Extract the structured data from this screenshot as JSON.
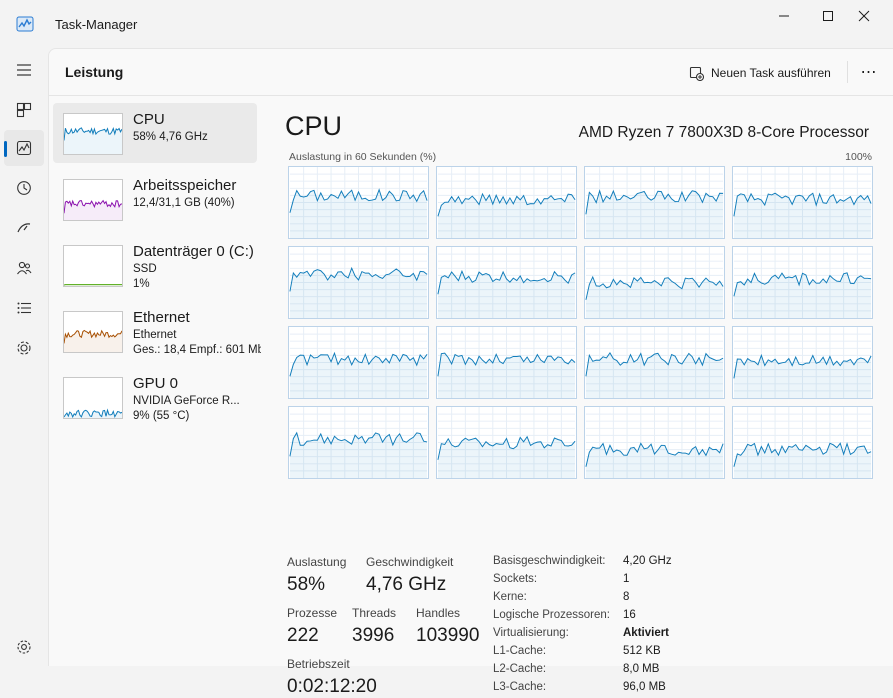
{
  "window": {
    "title": "Task-Manager"
  },
  "colors": {
    "cpu": "#117dbb",
    "memory": "#8b12ae",
    "disk": "#4da60c",
    "ethernet": "#a74f01",
    "gpu": "#117dbb"
  },
  "nav": {
    "items": [
      "menu-icon",
      "processes-icon",
      "performance-icon",
      "app-history-icon",
      "startup-icon",
      "users-icon",
      "details-icon",
      "services-icon"
    ],
    "settings": "settings-icon"
  },
  "header": {
    "title": "Leistung",
    "run_task_label": "Neuen Task ausführen",
    "more": "⋯"
  },
  "resources": [
    {
      "name": "CPU",
      "lines": [
        "58% 4,76 GHz"
      ],
      "usage": 58
    },
    {
      "name": "Arbeitsspeicher",
      "lines": [
        "12,4/31,1 GB (40%)"
      ],
      "usage": 40
    },
    {
      "name": "Datenträger 0 (C:)",
      "lines": [
        "SSD",
        "1%"
      ],
      "usage": 1
    },
    {
      "name": "Ethernet",
      "lines": [
        "Ethernet",
        "Ges.: 18,4 Empf.: 601 Mb"
      ],
      "usage": 45
    },
    {
      "name": "GPU 0",
      "lines": [
        "NVIDIA GeForce R...",
        "9% (55 °C)"
      ],
      "usage": 9
    }
  ],
  "detail": {
    "title": "CPU",
    "model": "AMD Ryzen 7 7800X3D 8-Core Processor",
    "graph_caption": "Auslastung in 60 Sekunden (%)",
    "graph_max": "100%",
    "core_usage": [
      60,
      55,
      58,
      55,
      62,
      58,
      50,
      55,
      55,
      55,
      55,
      52,
      55,
      50,
      40,
      40
    ],
    "stats": {
      "auslastung_label": "Auslastung",
      "auslastung": "58%",
      "geschwindigkeit_label": "Geschwindigkeit",
      "geschwindigkeit": "4,76 GHz",
      "prozesse_label": "Prozesse",
      "prozesse": "222",
      "threads_label": "Threads",
      "threads": "3996",
      "handles_label": "Handles",
      "handles": "103990",
      "betriebszeit_label": "Betriebszeit",
      "betriebszeit": "0:02:12:20"
    },
    "specs": [
      {
        "key": "Basisgeschwindigkeit:",
        "value": "4,20 GHz"
      },
      {
        "key": "Sockets:",
        "value": "1"
      },
      {
        "key": "Kerne:",
        "value": "8"
      },
      {
        "key": "Logische Prozessoren:",
        "value": "16"
      },
      {
        "key": "Virtualisierung:",
        "value": "Aktiviert",
        "bold": true
      },
      {
        "key": "L1-Cache:",
        "value": "512 KB"
      },
      {
        "key": "L2-Cache:",
        "value": "8,0 MB"
      },
      {
        "key": "L3-Cache:",
        "value": "96,0 MB"
      }
    ]
  }
}
